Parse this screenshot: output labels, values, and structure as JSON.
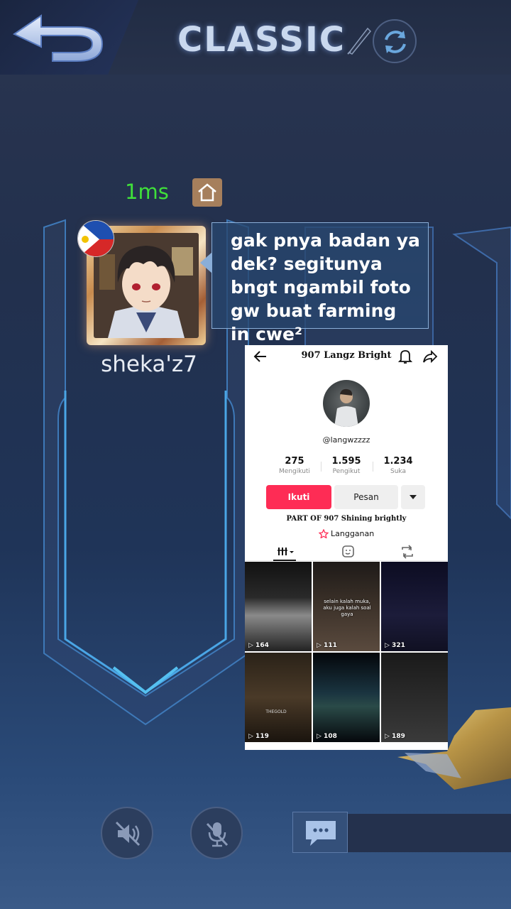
{
  "header": {
    "mode_title": "CLASSIC",
    "back_icon": "back-arrow-icon",
    "refresh_icon": "refresh-icon"
  },
  "player": {
    "ping": "1ms",
    "username": "sheka'z7",
    "flag": "philippines-flag-icon",
    "chat_message": "gak pnya badan ya dek? segitunya bngt ngambil foto gw buat farming in cwe²"
  },
  "tiktok": {
    "title": "907 Langz Bright",
    "handle": "@langwzzzz",
    "stats": [
      {
        "value": "275",
        "label": "Mengikuti"
      },
      {
        "value": "1.595",
        "label": "Pengikut"
      },
      {
        "value": "1.234",
        "label": "Suka"
      }
    ],
    "follow_label": "Ikuti",
    "message_label": "Pesan",
    "bio": "PART OF 907 Shining brightly",
    "subscription_label": "Langganan",
    "videos": [
      {
        "views": "164"
      },
      {
        "views": "111",
        "caption": "selain kalah muka, aku juga kalah soal gaya"
      },
      {
        "views": "321"
      },
      {
        "views": "119",
        "tag": "THEGOLD"
      },
      {
        "views": "108"
      },
      {
        "views": "189"
      }
    ]
  },
  "colors": {
    "ping": "#3fe03a",
    "follow": "#fe2c55",
    "home": "#a67f5c"
  }
}
